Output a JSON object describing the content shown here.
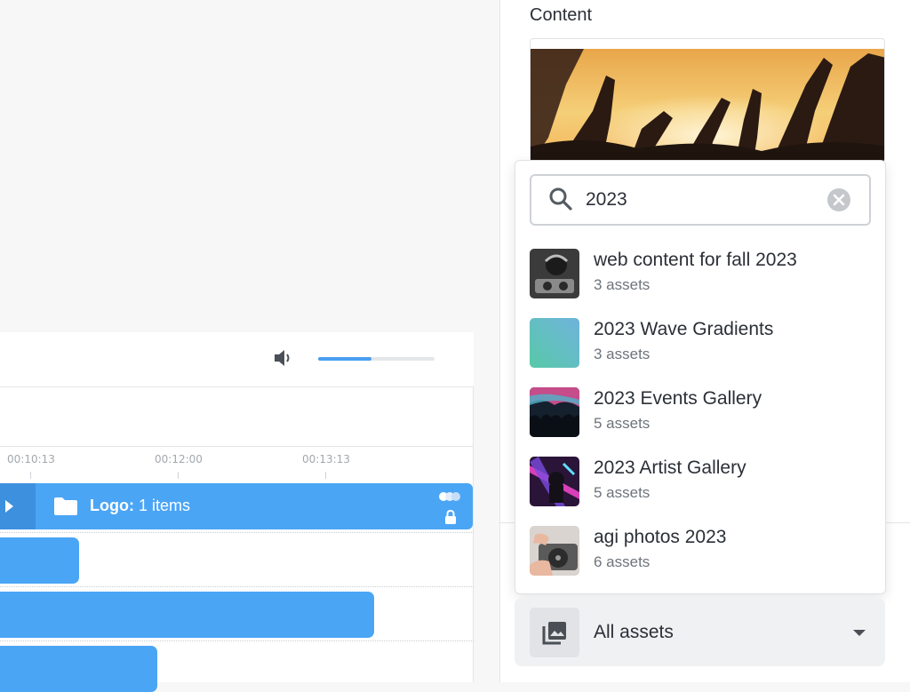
{
  "player": {
    "volume_level": 0.46
  },
  "timeline": {
    "ticks": [
      "00:10:13",
      "00:12:00",
      "00:13:13"
    ],
    "logo_track": {
      "name": "Logo:",
      "count": "1 items"
    }
  },
  "sidebar": {
    "content_label": "Content"
  },
  "search": {
    "query": "2023",
    "results": [
      {
        "name": "web content for fall 2023",
        "count": "3 assets",
        "thumb": "bw-dj-photo"
      },
      {
        "name": "2023 Wave Gradients",
        "count": "3 assets",
        "thumb": "teal-gradient"
      },
      {
        "name": "2023 Events Gallery",
        "count": "5 assets",
        "thumb": "concert-crowd"
      },
      {
        "name": "2023 Artist Gallery",
        "count": "5 assets",
        "thumb": "neon-artist"
      },
      {
        "name": "agi photos 2023",
        "count": "6 assets",
        "thumb": "turntable"
      }
    ]
  },
  "asset_filter": {
    "selected": "All assets"
  },
  "colors": {
    "accent": "#4aa5f5",
    "text": "#2b2f36",
    "muted": "#6e747b"
  }
}
